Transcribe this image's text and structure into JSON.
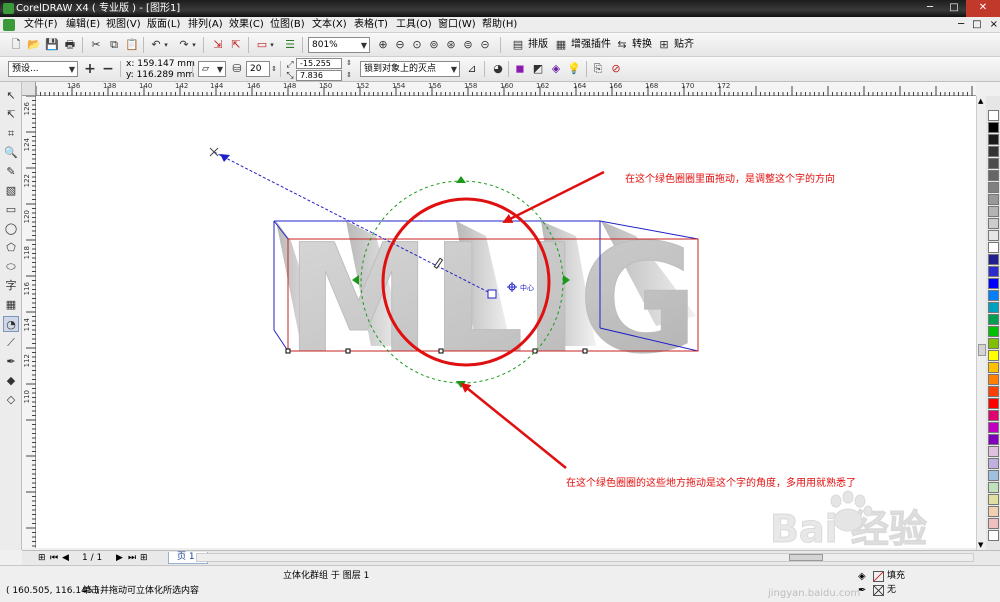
{
  "window": {
    "title": "CorelDRAW X4 ( 专业版 ) - [图形1]",
    "controls": [
      "─",
      "□",
      "✕"
    ]
  },
  "menu": [
    "文件(F)",
    "编辑(E)",
    "视图(V)",
    "版面(L)",
    "排列(A)",
    "效果(C)",
    "位图(B)",
    "文本(X)",
    "表格(T)",
    "工具(O)",
    "窗口(W)",
    "帮助(H)"
  ],
  "mdi_controls": [
    "─",
    "□",
    "×"
  ],
  "toolbar1": {
    "zoom": "801%",
    "buttons": [
      "排版",
      "增强插件",
      "转换",
      "贴齐"
    ]
  },
  "toolbar2": {
    "preset": "预设...",
    "x": "x:  159.147 mm",
    "y": "y:  116.289 mm",
    "depth": "20",
    "vp_x": "-15.255 mm",
    "vp_y": "7.836 mm",
    "vanish_mode": "锁到对象上的灭点"
  },
  "rulers": {
    "h_ticks": [
      "136",
      "138",
      "140",
      "142",
      "144",
      "146",
      "148",
      "150",
      "152",
      "154",
      "156",
      "158",
      "160",
      "162",
      "164",
      "166",
      "168",
      "170",
      "172"
    ],
    "v_ticks": [
      "126",
      "124",
      "122",
      "120",
      "118",
      "116",
      "114",
      "112",
      "110"
    ]
  },
  "canvas": {
    "extrude_text": "MLIG",
    "center_label": "中心",
    "annotation_top": "在这个绿色圈圈里面拖动，是调整这个字的方向",
    "annotation_bottom": "在这个绿色圈圈的这些地方拖动是这个字的角度，多用用就熟悉了",
    "watermark_brand": "Bai 经验",
    "watermark_url": "jingyan.baidu.com"
  },
  "pagebar": {
    "page_count": "1 / 1",
    "page_tab": "页 1"
  },
  "status": {
    "coords": "( 160.505, 116.145 )",
    "object_info": "立体化群组 于 图层 1",
    "hint": "单击并拖动可立体化所选内容",
    "fill_label": "填充",
    "outline_label": "无"
  },
  "colors": {
    "annotation": "#e01010",
    "selection_blue": "#2020c8",
    "rotation_green": "#1a9a1a",
    "extrude_edge": "#c82020"
  },
  "palette": [
    "#ffffff",
    "#000000",
    "#1a1a1a",
    "#333333",
    "#4d4d4d",
    "#666666",
    "#808080",
    "#999999",
    "#b3b3b3",
    "#cccccc",
    "#e6e6e6",
    "#ffffff",
    "#1f1f8f",
    "#2b2bd0",
    "#0000ff",
    "#0080ff",
    "#00a0c0",
    "#00a050",
    "#00c000",
    "#80c000",
    "#ffff00",
    "#ffc000",
    "#ff8000",
    "#ff4000",
    "#ff0000",
    "#e00070",
    "#c000c0",
    "#8000c0",
    "#e0c0e0",
    "#c0b0e0",
    "#a0c0e0",
    "#c0e0c0",
    "#e0e0a0",
    "#f0d0b0",
    "#f0c0c0",
    "#ffffff"
  ]
}
